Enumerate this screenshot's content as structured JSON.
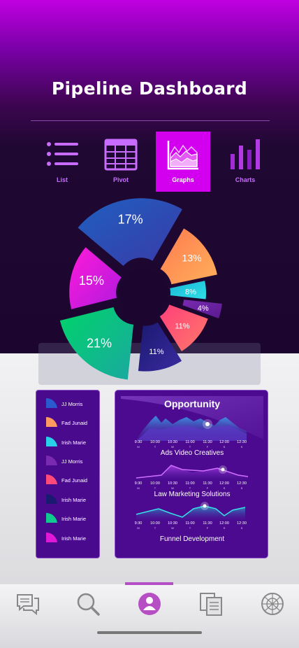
{
  "title": "Pipeline Dashboard",
  "tabs": [
    {
      "label": "List",
      "icon": "list-icon",
      "active": false
    },
    {
      "label": "Pivot",
      "icon": "table-icon",
      "active": false
    },
    {
      "label": "Graphs",
      "icon": "area-graph-icon",
      "active": true
    },
    {
      "label": "Charts",
      "icon": "bar-chart-icon",
      "active": false
    }
  ],
  "pie": {
    "slices": [
      {
        "label": "17%",
        "value": 17,
        "colors": [
          "#1f5fbf",
          "#3a3aa8"
        ]
      },
      {
        "label": "13%",
        "value": 13,
        "colors": [
          "#ff7a50",
          "#ffb05a"
        ]
      },
      {
        "label": "8%",
        "value": 8,
        "colors": [
          "#1ab6d8",
          "#2fe0e6"
        ]
      },
      {
        "label": "4%",
        "value": 4,
        "colors": [
          "#7a2ab0",
          "#5a1a90"
        ]
      },
      {
        "label": "11%",
        "value": 11,
        "colors": [
          "#ff3f7a",
          "#ff7a6a"
        ]
      },
      {
        "label": "11%",
        "value": 11,
        "colors": [
          "#1a1a70",
          "#3a2aa0"
        ]
      },
      {
        "label": "21%",
        "value": 21,
        "colors": [
          "#00d46a",
          "#1aa8a0"
        ]
      },
      {
        "label": "15%",
        "value": 15,
        "colors": [
          "#ff1ad8",
          "#b01ae0"
        ]
      }
    ]
  },
  "legend": {
    "items": [
      {
        "name": "JJ Morris",
        "color": "#2a5ad0"
      },
      {
        "name": "Fad Junaid",
        "color": "#ff9a60"
      },
      {
        "name": "Irish Marie",
        "color": "#2ad0e8"
      },
      {
        "name": "JJ Morris",
        "color": "#7a2ab0"
      },
      {
        "name": "Fad Junaid",
        "color": "#ff4a7a"
      },
      {
        "name": "Irish Marie",
        "color": "#1a1a70"
      },
      {
        "name": "Irish Marie",
        "color": "#10c890"
      },
      {
        "name": "Irish Marie",
        "color": "#e018d8"
      }
    ]
  },
  "opportunity": {
    "title": "Opportunity",
    "time_labels": [
      "9:30",
      "10:00",
      "10:30",
      "11:00",
      "11:30",
      "12:00",
      "12:30"
    ],
    "day_labels": [
      "M",
      "T",
      "W",
      "T",
      "F",
      "S",
      "S"
    ],
    "series": [
      {
        "name": "Ads Video Creatives",
        "color": "#3a8ae8"
      },
      {
        "name": "Law Marketing Solutions",
        "color": "#b040e8"
      },
      {
        "name": "Funnel Development",
        "color": "#24c8d8"
      }
    ]
  },
  "nav": {
    "items": [
      {
        "name": "chat-icon",
        "active": false
      },
      {
        "name": "search-icon",
        "active": false
      },
      {
        "name": "user-icon",
        "active": true
      },
      {
        "name": "documents-icon",
        "active": false
      },
      {
        "name": "globe-icon",
        "active": false
      }
    ]
  }
}
